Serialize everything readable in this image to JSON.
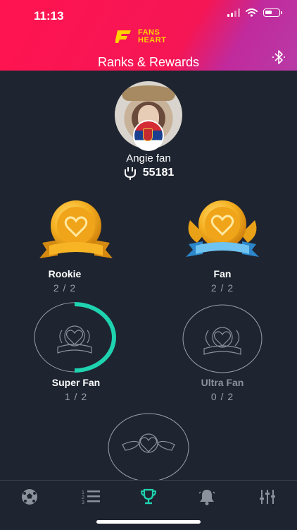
{
  "status_bar": {
    "time": "11:13"
  },
  "header": {
    "logo_line1": "FANS",
    "logo_line2": "HEART",
    "title": "Ranks & Rewards",
    "accent": "#ff1450"
  },
  "profile": {
    "name": "Angie fan",
    "points": "55181",
    "flag": "serbia-flag"
  },
  "ranks": [
    {
      "name": "Rookie",
      "progress": "2 / 2",
      "achieved": true,
      "fraction": 1.0
    },
    {
      "name": "Fan",
      "progress": "2 / 2",
      "achieved": true,
      "fraction": 1.0
    },
    {
      "name": "Super Fan",
      "progress": "1 / 2",
      "achieved": false,
      "fraction": 0.5
    },
    {
      "name": "Ultra Fan",
      "progress": "0 / 2",
      "achieved": false,
      "fraction": 0.0
    }
  ],
  "tabs": [
    "soccer-ball-icon",
    "ranked-list-icon",
    "trophy-icon",
    "bell-icon",
    "sliders-icon"
  ],
  "active_tab": "trophy-icon",
  "colors": {
    "progress": "#1fd3b0",
    "gold": "#f5b021",
    "background": "#1e2430"
  }
}
